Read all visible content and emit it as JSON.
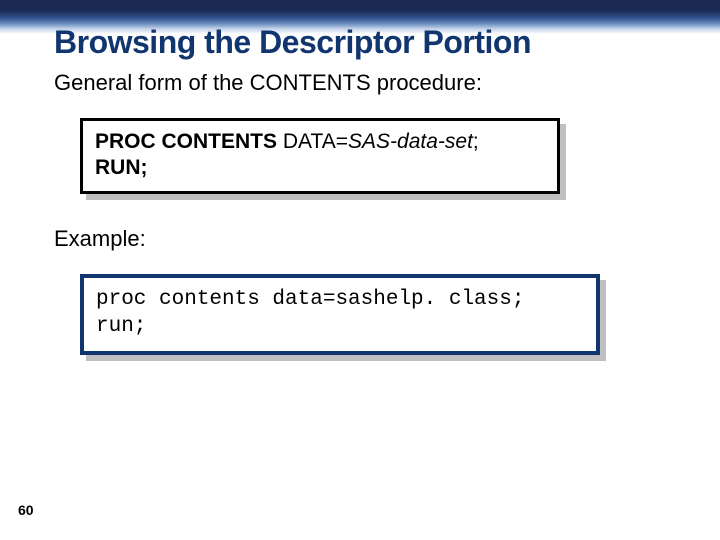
{
  "slide": {
    "title": "Browsing the Descriptor Portion",
    "intro": "General form of the CONTENTS procedure:",
    "syntax": {
      "line1_bold": "PROC CONTENTS",
      "line1_mid": " DATA=",
      "line1_italic": "SAS-data-set",
      "line1_end": ";",
      "line2": "RUN;"
    },
    "example_label": "Example:",
    "example": {
      "line1": "proc contents data=sashelp. class;",
      "line2": "run;"
    },
    "page_number": "60"
  }
}
